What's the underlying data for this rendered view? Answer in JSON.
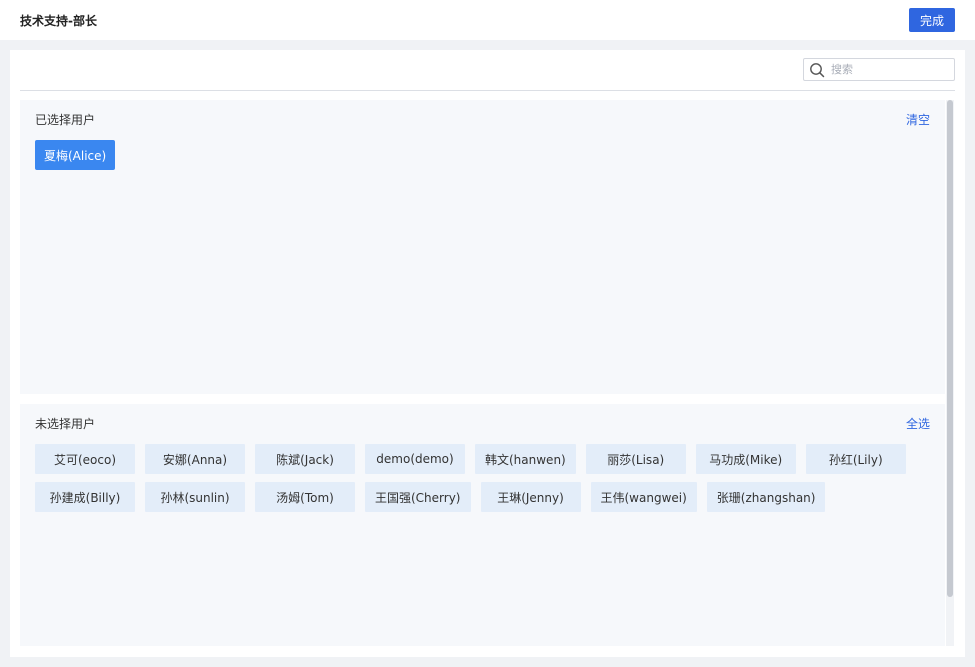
{
  "header": {
    "title": "技术支持-部长",
    "done_label": "完成"
  },
  "search": {
    "placeholder": "搜索",
    "value": ""
  },
  "selected": {
    "title": "已选择用户",
    "action_label": "清空",
    "users": [
      "夏梅(Alice)"
    ]
  },
  "unselected": {
    "title": "未选择用户",
    "action_label": "全选",
    "users": [
      "艾可(eoco)",
      "安娜(Anna)",
      "陈斌(Jack)",
      "demo(demo)",
      "韩文(hanwen)",
      "丽莎(Lisa)",
      "马功成(Mike)",
      "孙红(Lily)",
      "孙建成(Billy)",
      "孙林(sunlin)",
      "汤姆(Tom)",
      "王国强(Cherry)",
      "王琳(Jenny)",
      "王伟(wangwei)",
      "张珊(zhangshan)"
    ]
  },
  "icons": {
    "search": "search-icon"
  },
  "colors": {
    "accent": "#2f66e0",
    "selected_chip": "#3a87f0",
    "chip": "#e3edf9",
    "section_bg": "#f6f8fb"
  }
}
